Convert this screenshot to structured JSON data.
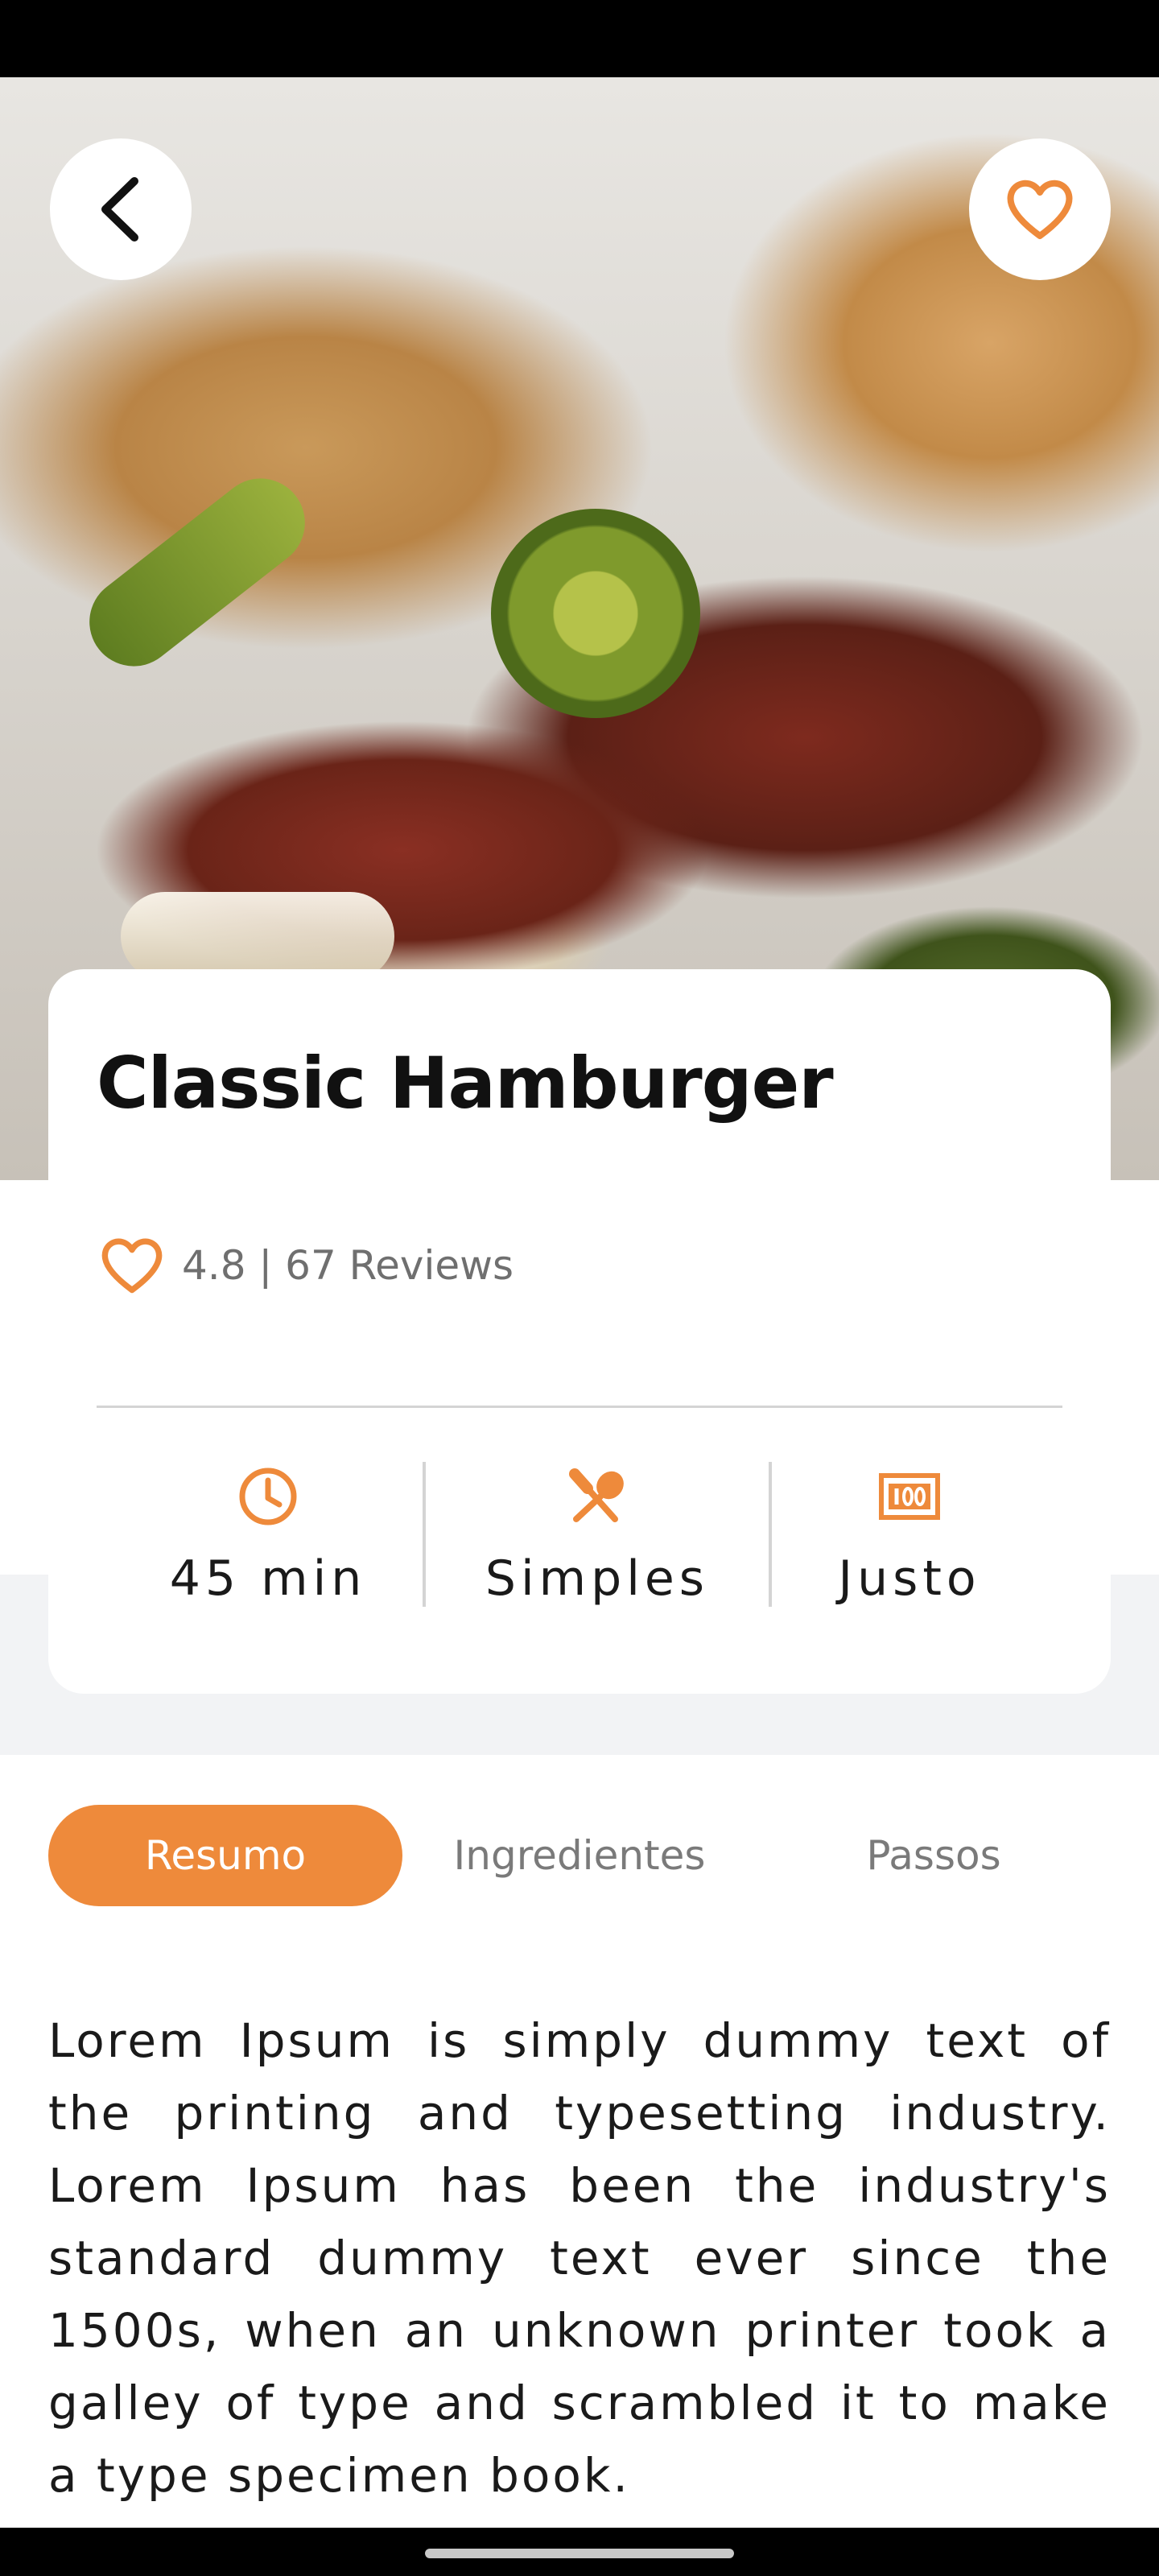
{
  "recipe": {
    "title": "Classic Hamburger",
    "rating_text": "4.8 | 67 Reviews"
  },
  "stats": [
    {
      "icon": "clock-icon",
      "label": "45 min"
    },
    {
      "icon": "utensils-icon",
      "label": "Simples"
    },
    {
      "icon": "price-tag-icon",
      "label": "Justo"
    }
  ],
  "tabs": [
    {
      "label": "Resumo",
      "active": true
    },
    {
      "label": "Ingredientes",
      "active": false
    },
    {
      "label": "Passos",
      "active": false
    }
  ],
  "summary_text": "Lorem Ipsum is simply dummy text of the printing and typesetting industry. Lorem Ipsum has been the industry's standard dummy text ever since the 1500s, when an unknown printer took a galley of type and scrambled it to make a type specimen book.",
  "colors": {
    "accent": "#ee8a3b",
    "text": "#1a1a1a",
    "muted": "#7a7a7a",
    "divider": "#d4d4d4",
    "page_bg": "#f2f3f5"
  }
}
